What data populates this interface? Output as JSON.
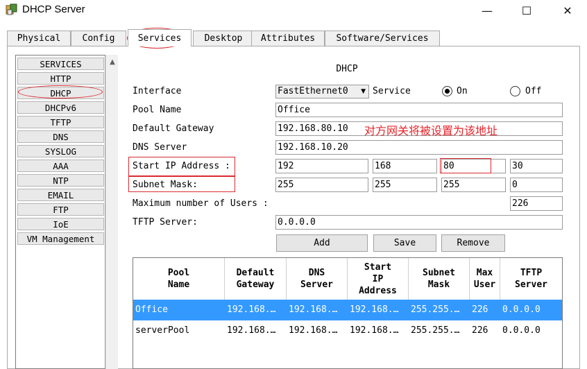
{
  "window": {
    "title": "DHCP Server",
    "minimize": "—",
    "maximize": "☐",
    "close": "✕"
  },
  "tabs": [
    {
      "label": "Physical"
    },
    {
      "label": "Config"
    },
    {
      "label": "Services",
      "active": true
    },
    {
      "label": "Desktop"
    },
    {
      "label": "Attributes"
    },
    {
      "label": "Software/Services"
    }
  ],
  "services": [
    "SERVICES",
    "HTTP",
    "DHCP",
    "DHCPv6",
    "TFTP",
    "DNS",
    "SYSLOG",
    "AAA",
    "NTP",
    "EMAIL",
    "FTP",
    "IoE",
    "VM Management"
  ],
  "services_selected": "DHCP",
  "panel": {
    "title": "DHCP",
    "interface_label": "Interface",
    "interface_value": "FastEthernet0",
    "service_label": "Service",
    "on_label": "On",
    "off_label": "Off",
    "service_state": "On",
    "pool_name_label": "Pool Name",
    "pool_name": "Office",
    "gateway_label": "Default Gateway",
    "gateway": "192.168.80.10",
    "dns_label": "DNS Server",
    "dns": "192.168.10.20",
    "start_ip_label": "Start IP Address :",
    "start_ip": [
      "192",
      "168",
      "80",
      "30"
    ],
    "mask_label": "Subnet Mask:",
    "mask": [
      "255",
      "255",
      "255",
      "0"
    ],
    "max_users_label": "Maximum number of Users :",
    "max_users": "226",
    "tftp_label": "TFTP Server:",
    "tftp": "0.0.0.0",
    "add_label": "Add",
    "save_label": "Save",
    "remove_label": "Remove"
  },
  "annotation_note": "对方网关将被设置为该地址",
  "table": {
    "headers": [
      [
        "Pool",
        "Name"
      ],
      [
        "Default",
        "Gateway"
      ],
      [
        "DNS",
        "Server"
      ],
      [
        "Start",
        "IP",
        "Address"
      ],
      [
        "Subnet",
        "Mask"
      ],
      [
        "Max",
        "User"
      ],
      [
        "TFTP",
        "Server"
      ]
    ],
    "rows": [
      {
        "cells": [
          "Office",
          "192.168.…",
          "192.168.…",
          "192.168.…",
          "255.255.…",
          "226",
          "0.0.0.0"
        ],
        "selected": true
      },
      {
        "cells": [
          "serverPool",
          "192.168.…",
          "192.168.…",
          "192.168.…",
          "255.255.…",
          "226",
          "0.0.0.0"
        ],
        "selected": false
      }
    ]
  },
  "colors": {
    "selection": "#3399ff",
    "annotation": "#d9292f"
  }
}
